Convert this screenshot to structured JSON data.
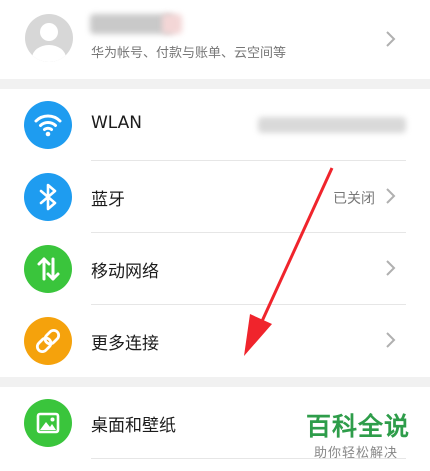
{
  "account": {
    "subtitle": "华为帐号、付款与账单、云空间等"
  },
  "connections": [
    {
      "label": "WLAN",
      "value": "",
      "icon": "wifi-icon",
      "color": "#1e9cf0"
    },
    {
      "label": "蓝牙",
      "value": "已关闭",
      "icon": "bluetooth-icon",
      "color": "#1e9cf0"
    },
    {
      "label": "移动网络",
      "value": "",
      "icon": "mobile-network-icon",
      "color": "#3ac53c"
    },
    {
      "label": "更多连接",
      "value": "",
      "icon": "link-icon",
      "color": "#f5a20c"
    }
  ],
  "display": [
    {
      "label": "桌面和壁纸",
      "icon": "image-icon",
      "color": "#3ac53c"
    }
  ],
  "annotation": {
    "color": "#f0242c"
  },
  "watermark": {
    "main": "百科全说",
    "sub": "助你轻松解决"
  }
}
